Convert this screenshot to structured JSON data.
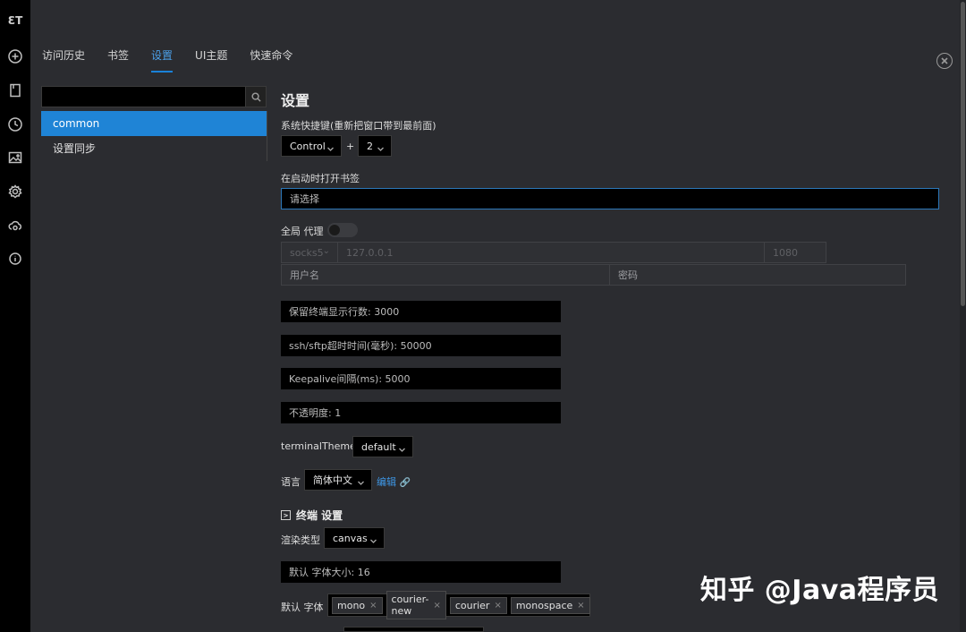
{
  "rail": {
    "icons": [
      "logo-icon",
      "add-icon",
      "bookmark-icon",
      "history-icon",
      "image-icon",
      "settings-icon",
      "cloud-sync-icon",
      "info-icon"
    ],
    "logo_text": "ƐT"
  },
  "tabs": [
    {
      "label": "访问历史",
      "active": false
    },
    {
      "label": "书签",
      "active": false
    },
    {
      "label": "设置",
      "active": true
    },
    {
      "label": "UI主题",
      "active": false
    },
    {
      "label": "快速命令",
      "active": false
    }
  ],
  "sidebar": {
    "search": {
      "value": ""
    },
    "items": [
      {
        "label": "common",
        "active": true
      },
      {
        "label": "设置同步",
        "active": false
      }
    ]
  },
  "main": {
    "title": "设置",
    "hotkey": {
      "label": "系统快捷键(重新把窗口带到最前面)",
      "modifier": "Control",
      "plus": "+",
      "key": "2"
    },
    "startup_bookmark": {
      "label": "在启动时打开书签",
      "placeholder": "请选择"
    },
    "proxy": {
      "label": "全局 代理",
      "enabled": false,
      "type": "socks5",
      "host": "127.0.0.1",
      "port": "1080",
      "username_placeholder": "用户名",
      "password_placeholder": "密码"
    },
    "fields": [
      "保留终端显示行数: 3000",
      "ssh/sftp超时时间(毫秒): 50000",
      "Keepalive间隔(ms): 5000",
      "不透明度: 1"
    ],
    "terminal_theme": {
      "label": "terminalTheme",
      "value": "default"
    },
    "language": {
      "label": "语言",
      "value": "简体中文",
      "edit_link": "编辑"
    },
    "terminal_section": {
      "title": "终端 设置",
      "render_label": "渲染类型",
      "render_value": "canvas",
      "font_size_field": "默认 字体大小: 16",
      "font_label": "默认 字体",
      "fonts": [
        "mono",
        "courier-new",
        "courier",
        "monospace"
      ]
    }
  },
  "watermark": "知乎 @Java程序员",
  "colors": {
    "accent": "#1f84d6",
    "link": "#3e97e6",
    "panel": "#2b2c30"
  }
}
